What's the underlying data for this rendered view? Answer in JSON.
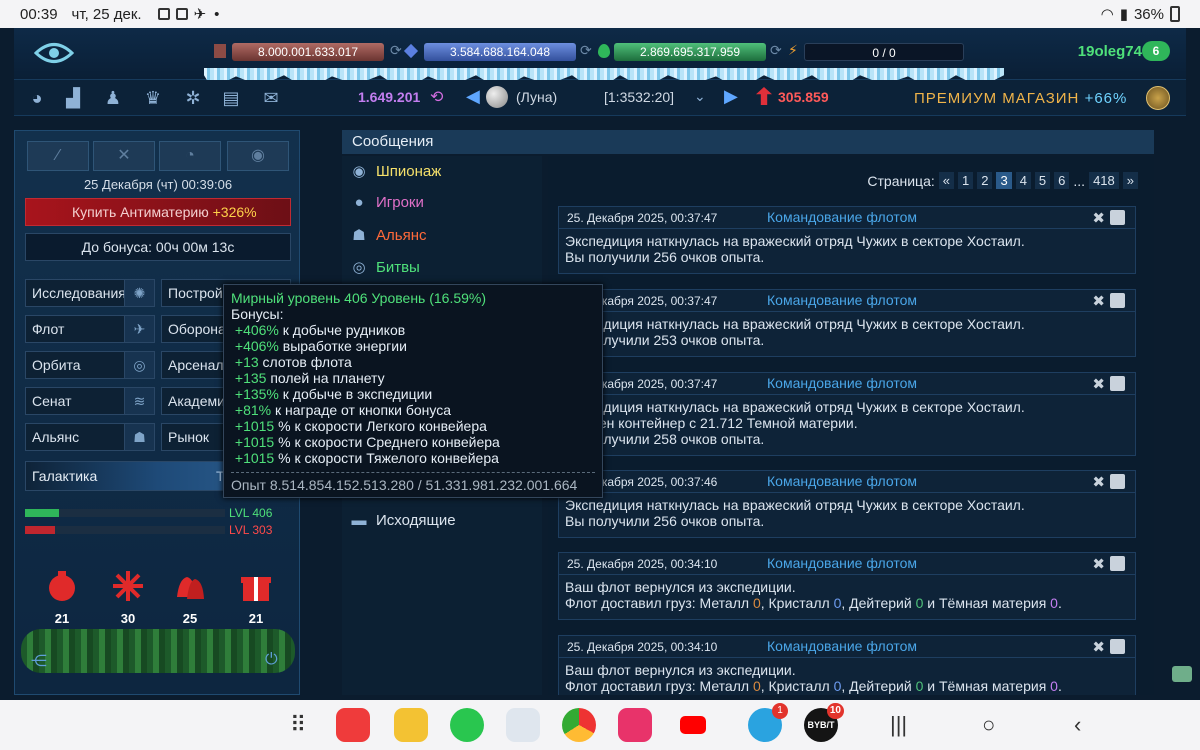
{
  "statusbar": {
    "time": "00:39",
    "date": "чт, 25 дек.",
    "dot": "•",
    "battery": "36%"
  },
  "header": {
    "metal": "8.000.001.633.017",
    "crystal": "3.584.688.164.048",
    "deuterium": "2.869.695.317.959",
    "energy": "0 / 0",
    "username": "19oleg74",
    "user_level": "6",
    "gold": "1.649.201",
    "planet": "(Луна)",
    "coords": "[1:3532:20]",
    "rank": "305.859",
    "premium_label": "ПРЕМИУМ МАГАЗИН",
    "premium_bonus": "+66%"
  },
  "left": {
    "datetime": "25 Декабря (чт) 00:39:06",
    "buy_label": "Купить Антиматерию",
    "buy_bonus": "+326%",
    "bonus_timer": "До бонуса: 00ч 00м 13с",
    "menu": [
      {
        "label": "Исследования"
      },
      {
        "label": "Постройки"
      },
      {
        "label": "Флот"
      },
      {
        "label": "Оборона"
      },
      {
        "label": "Орбита"
      },
      {
        "label": "Арсенал"
      },
      {
        "label": "Сенат"
      },
      {
        "label": "Академия"
      },
      {
        "label": "Альянс"
      },
      {
        "label": "Рынок"
      }
    ],
    "galaxy": "Галактика",
    "galaxy_right": "Т",
    "lvl1": "LVL 406",
    "lvl1_fill": 0.17,
    "lvl2": "LVL 303",
    "lvl2_fill": 0.15,
    "ornaments": [
      "21",
      "30",
      "25",
      "21"
    ]
  },
  "messages": {
    "title": "Сообщения",
    "categories": [
      {
        "label": "Шпионаж",
        "color": "#f5e06a"
      },
      {
        "label": "Игроки",
        "color": "#e070c8"
      },
      {
        "label": "Альянс",
        "color": "#ff6a3a"
      },
      {
        "label": "Битвы",
        "color": "#4fe07a"
      },
      {
        "label": "Исходящие",
        "color": "#dbe4ee"
      }
    ],
    "pager": {
      "label": "Страница:",
      "prev": "«",
      "pages": [
        "1",
        "2",
        "3",
        "4",
        "5",
        "6"
      ],
      "current": "3",
      "ellipsis": "...",
      "last": "418",
      "next": "»"
    },
    "items": [
      {
        "date": "25. Декабря 2025, 00:37:47",
        "from": "Командование флотом",
        "lines": [
          "Экспедиция наткнулась на вражеский отряд Чужих в секторе Хостаил.",
          "Вы получили 256 очков опыта."
        ]
      },
      {
        "date": "25. Декабря 2025, 00:37:47",
        "from": "Командование флотом",
        "lines": [
          "Экспедиция наткнулась на вражеский отряд Чужих в секторе Хостаил.",
          "Вы получили 253 очков опыта."
        ]
      },
      {
        "date": "25. Декабря 2025, 00:37:47",
        "from": "Командование флотом",
        "lines": [
          "Экспедиция наткнулась на вражеский отряд Чужих в секторе Хостаил.",
          "Найден контейнер с 21.712 Темной материи.",
          "Вы получили 258 очков опыта."
        ]
      },
      {
        "date": "25. Декабря 2025, 00:37:46",
        "from": "Командование флотом",
        "lines": [
          "Экспедиция наткнулась на вражеский отряд Чужих в секторе Хостаил.",
          "Вы получили 256 очков опыта."
        ]
      },
      {
        "date": "25. Декабря 2025, 00:34:10",
        "from": "Командование флотом",
        "line1": "Ваш флот вернулся из экспедиции.",
        "cargo": {
          "prefix": "Флот доставил груз: Металл ",
          "m": "0",
          "k_label": ", Кристалл ",
          "k": "0",
          "d_label": ", Дейтерий ",
          "d": "0",
          "t_label": " и Тёмная материя ",
          "t": "0",
          "end": "."
        }
      },
      {
        "date": "25. Декабря 2025, 00:34:10",
        "from": "Командование флотом",
        "line1": "Ваш флот вернулся из экспедиции.",
        "cargo": {
          "prefix": "Флот доставил груз: Металл ",
          "m": "0",
          "k_label": ", Кристалл ",
          "k": "0",
          "d_label": ", Дейтерий ",
          "d": "0",
          "t_label": " и Тёмная материя ",
          "t": "0",
          "end": "."
        }
      }
    ]
  },
  "tooltip": {
    "title": "Мирный уровень 406 Уровень (16.59%)",
    "bonuses_label": "Бонусы:",
    "rows": [
      {
        "v": "+406%",
        "t": " к добыче рудников"
      },
      {
        "v": "+406%",
        "t": " выработке энергии"
      },
      {
        "v": "+13",
        "t": " слотов флота"
      },
      {
        "v": "+135",
        "t": " полей на планету"
      },
      {
        "v": "+135%",
        "t": " к добыче в экспедиции"
      },
      {
        "v": "+81%",
        "t": " к награде от кнопки бонуса"
      },
      {
        "v": "+1015",
        "t": " % к скорости Легкого конвейера"
      },
      {
        "v": "+1015",
        "t": " % к скорости Среднего конвейера"
      },
      {
        "v": "+1015",
        "t": " % к скорости Тяжелого конвейера"
      }
    ],
    "xp": "Опыт 8.514.854.152.513.280 / 51.331.981.232.001.664"
  },
  "navbar": {
    "telegram_badge": "1",
    "bybit_label": "BYB/T",
    "bybit_badge": "10"
  }
}
